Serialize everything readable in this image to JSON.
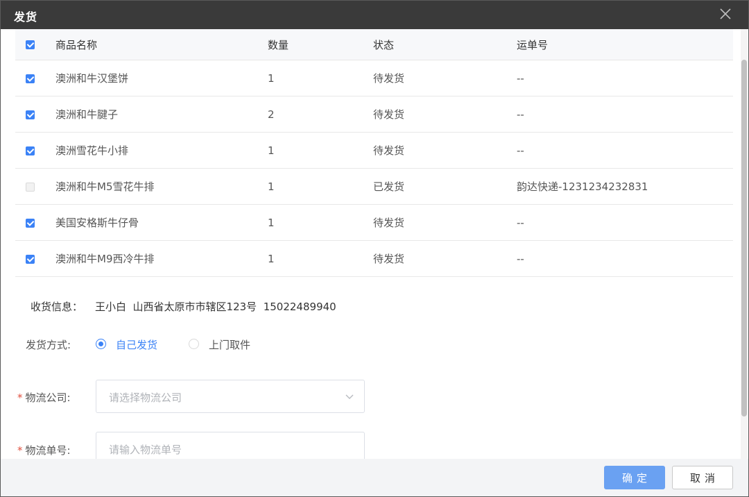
{
  "dialog": {
    "title": "发货"
  },
  "table": {
    "headers": [
      "商品名称",
      "数量",
      "状态",
      "运单号"
    ],
    "rows": [
      {
        "checked": true,
        "name": "澳洲和牛汉堡饼",
        "qty": "1",
        "status": "待发货",
        "tracking": "--"
      },
      {
        "checked": true,
        "name": "澳洲和牛腱子",
        "qty": "2",
        "status": "待发货",
        "tracking": "--"
      },
      {
        "checked": true,
        "name": "澳洲雪花牛小排",
        "qty": "1",
        "status": "待发货",
        "tracking": "--"
      },
      {
        "checked": false,
        "name": "澳洲和牛M5雪花牛排",
        "qty": "1",
        "status": "已发货",
        "tracking": "韵达快递-1231234232831"
      },
      {
        "checked": true,
        "name": "美国安格斯牛仔骨",
        "qty": "1",
        "status": "待发货",
        "tracking": "--"
      },
      {
        "checked": true,
        "name": "澳洲和牛M9西冷牛排",
        "qty": "1",
        "status": "待发货",
        "tracking": "--"
      }
    ]
  },
  "receiver": {
    "label": "收货信息：",
    "value": "王小白  山西省太原市市辖区123号  15022489940"
  },
  "shipping_method": {
    "label": "发货方式:",
    "options": [
      "自己发货",
      "上门取件"
    ],
    "selected": "自己发货"
  },
  "logistics_company": {
    "required_mark": "*",
    "label": "物流公司:",
    "placeholder": "请选择物流公司"
  },
  "tracking_number": {
    "required_mark": "*",
    "label": "物流单号:",
    "placeholder": "请输入物流单号"
  },
  "footer": {
    "confirm_label": "确定",
    "cancel_label": "取消"
  },
  "colors": {
    "accent": "#3b82f6",
    "shipped": "#52c41a",
    "required": "#e0503f"
  }
}
